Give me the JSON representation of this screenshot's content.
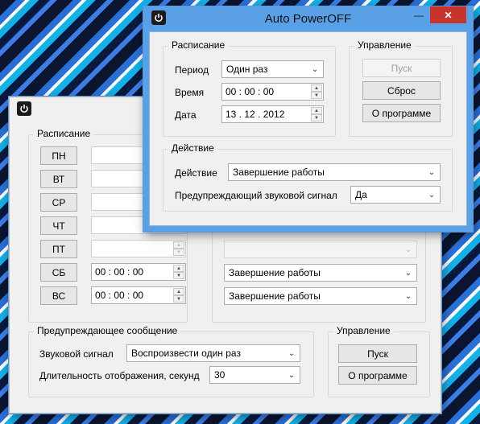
{
  "back_window": {
    "schedule_group": "Расписание",
    "days": [
      {
        "label": "ПН",
        "time": ""
      },
      {
        "label": "ВТ",
        "time": ""
      },
      {
        "label": "СР",
        "time": ""
      },
      {
        "label": "ЧТ",
        "time": ""
      },
      {
        "label": "ПТ",
        "time": ""
      },
      {
        "label": "СБ",
        "time": "00 : 00 : 00"
      },
      {
        "label": "ВС",
        "time": "00 : 00 : 00"
      }
    ],
    "actions": [
      "",
      "",
      "Завершение работы",
      "Завершение работы"
    ],
    "warning_group": "Предупреждающее сообщение",
    "sound_label": "Звуковой сигнал",
    "sound_value": "Воспроизвести один раз",
    "duration_label": "Длительность отображения, секунд",
    "duration_value": "30",
    "control_group": "Управление",
    "start_button": "Пуск",
    "about_button": "О программе"
  },
  "front_window": {
    "title": "Auto PowerOFF",
    "minimize": "—",
    "close": "✕",
    "schedule_group": "Расписание",
    "period_label": "Период",
    "period_value": "Один раз",
    "time_label": "Время",
    "time_value": "00 : 00 : 00",
    "date_label": "Дата",
    "date_value": "13 . 12 . 2012",
    "control_group": "Управление",
    "start_button": "Пуск",
    "reset_button": "Сброс",
    "about_button": "О программе",
    "action_group": "Действие",
    "action_label": "Действие",
    "action_value": "Завершение работы",
    "warn_label": "Предупреждающий звуковой сигнал",
    "warn_value": "Да"
  },
  "icons": {
    "app": "power-icon",
    "spin_up": "▲",
    "spin_down": "▼",
    "dropdown": "⌄"
  },
  "colors": {
    "accent_border": "#5aa0e6",
    "close_button": "#c7342b"
  }
}
